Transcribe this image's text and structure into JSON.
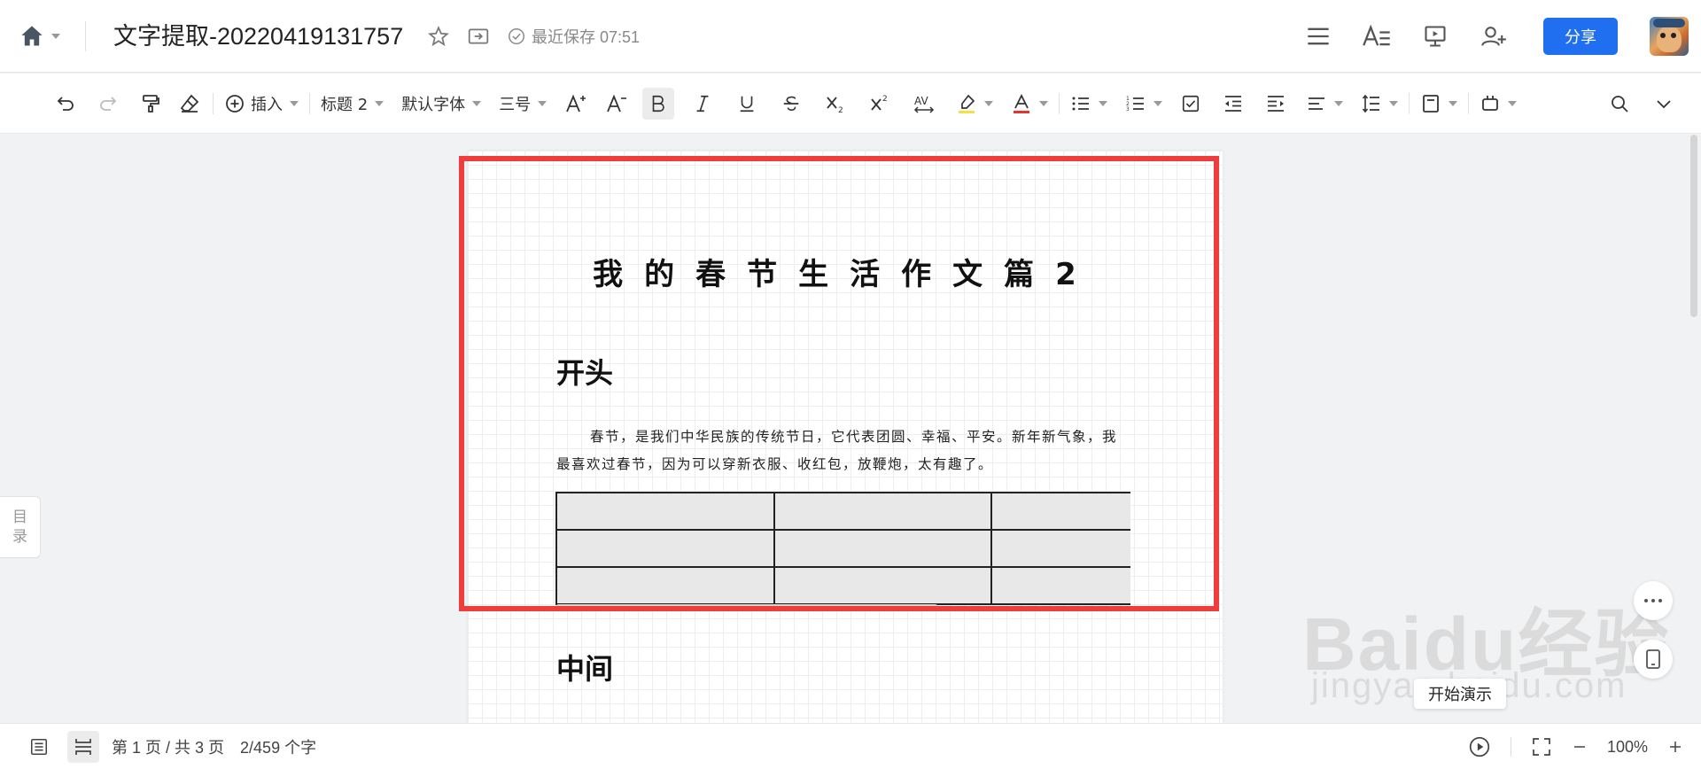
{
  "header": {
    "doc_title": "文字提取-20220419131757",
    "save_status": "最近保存 07:51",
    "share_label": "分享"
  },
  "toolbar": {
    "insert_label": "插入",
    "heading_style": "标题 2",
    "font_family": "默认字体",
    "font_size": "三号"
  },
  "sidebar": {
    "outline_label_1": "目",
    "outline_label_2": "录"
  },
  "document": {
    "title": "我的春节生活作文篇2",
    "section1_heading": "开头",
    "section1_paragraph": "春节，是我们中华民族的传统节日，它代表团圆、幸福、平安。新年新气象，我最喜欢过春节，因为可以穿新衣服、收红包，放鞭炮，太有趣了。",
    "section2_heading": "中间",
    "table": {
      "rows": 3,
      "cols": 3
    }
  },
  "overlay": {
    "tooltip": "开始演示",
    "watermark": "Baidu经验",
    "watermark_url": "jingyan.baidu.com"
  },
  "status": {
    "page_info": "第 1 页 / 共 3 页",
    "word_count": "2/459 个字",
    "zoom": "100%"
  },
  "colors": {
    "accent": "#1f6ff0",
    "highlight_bar": "#f5e04a",
    "font_color_bar": "#e83333",
    "frame": "#ee3d3d"
  }
}
